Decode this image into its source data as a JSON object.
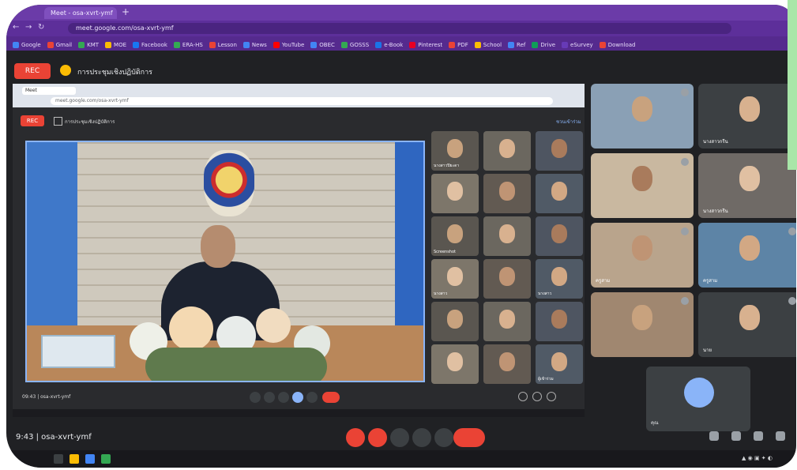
{
  "browser": {
    "tab_title": "Meet - osa-xvrt-ymf",
    "url": "meet.google.com/osa-xvrt-ymf",
    "bookmarks": [
      "Google",
      "Gmail",
      "KMT",
      "MOE",
      "Facebook",
      "ERA-HS",
      "Lesson",
      "News",
      "YouTube",
      "OBEC",
      "GOSSS",
      "e-Book",
      "Pinterest",
      "PDF",
      "School",
      "Ref",
      "Drive",
      "eSurvey",
      "Download"
    ]
  },
  "meet": {
    "record_label": "REC",
    "header_title": "การประชุมเชิงปฏิบัติการ",
    "presenter_title": "การประชุมเชิงปฏิบัติการ"
  },
  "inner_browser": {
    "tab_title": "Meet",
    "url": "meet.google.com/osa-xvrt-ymf",
    "record_label": "REC",
    "link_label": "ชวนเข้าร่วม"
  },
  "participants_grid": [
    "นางสาวปิยะดา",
    "",
    "",
    "",
    "",
    "",
    "Screenshot",
    "",
    "",
    "นางสาว",
    "",
    "นางสาว",
    "",
    "",
    "",
    "",
    "",
    "ผู้เข้าร่วม"
  ],
  "right_tiles": [
    {
      "label": ""
    },
    {
      "label": "นางสาวกรีน"
    },
    {
      "label": ""
    },
    {
      "label": "นางสาวกรีน"
    },
    {
      "label": "ครูสาม"
    },
    {
      "label": "ครูสาม"
    },
    {
      "label": ""
    },
    {
      "label": "นาย"
    }
  ],
  "self_tile": {
    "label": "คุณ"
  },
  "bottom_bar": {
    "meeting_info": "9:43 | osa-xvrt-ymf"
  },
  "inner_meeting_info": "09:43 | osa-xvrt-ymf",
  "colors": {
    "chrome_purple": "#6b3ba8",
    "meet_bg": "#202124",
    "record_red": "#ea4335",
    "accent_blue": "#8ab4f8"
  }
}
